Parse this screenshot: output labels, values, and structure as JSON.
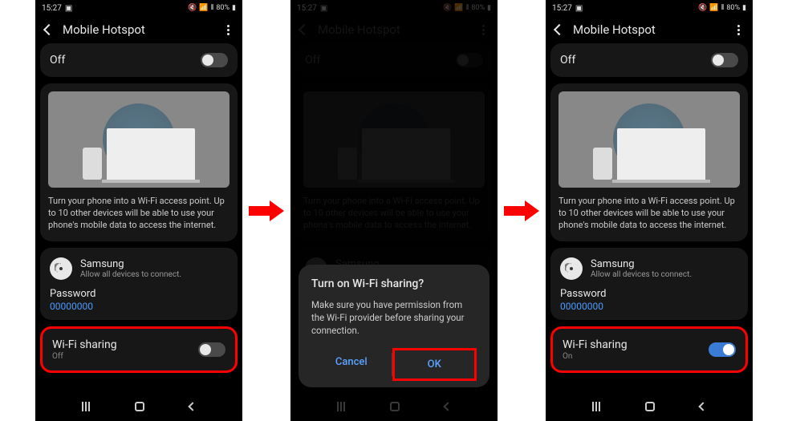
{
  "status": {
    "time": "15:27",
    "battery": "80%"
  },
  "header": {
    "title": "Mobile Hotspot"
  },
  "main_toggle": {
    "label": "Off"
  },
  "hero_text": "Turn your phone into a Wi-Fi access point. Up to 10 other devices will be able to use your phone's mobile data to access the internet.",
  "network": {
    "name": "Samsung",
    "sub": "Allow all devices to connect.",
    "password_label": "Password",
    "password_value": "00000000"
  },
  "wifi_sharing": {
    "label": "Wi-Fi sharing",
    "state_off": "Off",
    "state_on": "On"
  },
  "dialog": {
    "title": "Turn on Wi-Fi sharing?",
    "body": "Make sure you have permission from the Wi-Fi provider before sharing your connection.",
    "cancel": "Cancel",
    "ok": "OK"
  }
}
